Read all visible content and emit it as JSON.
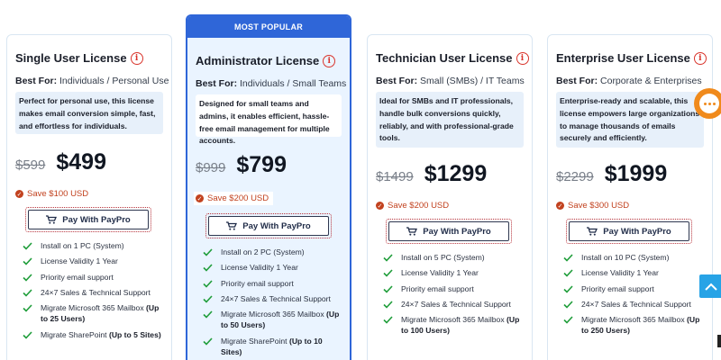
{
  "colors": {
    "accent_blue": "#2f66d8",
    "save_red": "#c2421f",
    "check_green": "#1f9d3a",
    "chat_orange": "#f08a1c",
    "scroll_blue": "#27a3e6"
  },
  "icons": {
    "info": "info-circle-icon",
    "save": "check-badge-icon",
    "cart": "cart-icon",
    "feature": "checkmark-icon",
    "chat": "chat-icon",
    "scroll_top": "chevron-up-icon"
  },
  "best_for_label": "Best For:",
  "pay_label": "Pay With PayPro",
  "popular_banner": "MOST POPULAR",
  "plans": [
    {
      "title": "Single User License",
      "best_for": "Individuals / Personal Use",
      "description": "Perfect for personal use, this license makes email conversion simple, fast, and effortless for individuals.",
      "old_price": "$599",
      "price": "$499",
      "save": "Save $100 USD",
      "features": [
        {
          "text": "Install on 1 PC (System)",
          "bold": ""
        },
        {
          "text": "License Validity 1 Year",
          "bold": ""
        },
        {
          "text": "Priority email support",
          "bold": ""
        },
        {
          "text": "24×7 Sales & Technical Support",
          "bold": ""
        },
        {
          "text": "Migrate Microsoft 365 Mailbox ",
          "bold": "(Up to 25 Users)"
        },
        {
          "text": "Migrate SharePoint ",
          "bold": "(Up to 5 Sites)"
        }
      ]
    },
    {
      "title": "Administrator License",
      "best_for": "Individuals / Small Teams",
      "description": "Designed for small teams and admins, it enables efficient, hassle-free email management for multiple accounts.",
      "old_price": "$999",
      "price": "$799",
      "save": "Save $200 USD",
      "features": [
        {
          "text": "Install on 2 PC (System)",
          "bold": ""
        },
        {
          "text": "License Validity 1 Year",
          "bold": ""
        },
        {
          "text": "Priority email support",
          "bold": ""
        },
        {
          "text": "24×7 Sales & Technical Support",
          "bold": ""
        },
        {
          "text": "Migrate Microsoft 365 Mailbox ",
          "bold": "(Up to 50 Users)"
        },
        {
          "text": "Migrate SharePoint ",
          "bold": "(Up to 10 Sites)"
        }
      ]
    },
    {
      "title": "Technician User License",
      "best_for": "Small (SMBs) / IT Teams",
      "description": "Ideal for SMBs and IT professionals, handle bulk conversions quickly, reliably, and with professional-grade tools.",
      "old_price": "$1499",
      "price": "$1299",
      "save": "Save $200 USD",
      "features": [
        {
          "text": "Install on 5 PC (System)",
          "bold": ""
        },
        {
          "text": "License Validity 1 Year",
          "bold": ""
        },
        {
          "text": "Priority email support",
          "bold": ""
        },
        {
          "text": "24×7 Sales & Technical Support",
          "bold": ""
        },
        {
          "text": "Migrate Microsoft 365 Mailbox ",
          "bold": "(Up to 100 Users)"
        }
      ]
    },
    {
      "title": "Enterprise User License",
      "best_for": "Corporate & Enterprises",
      "description": "Enterprise-ready and scalable, this license empowers large organizations to manage thousands of emails securely and efficiently.",
      "old_price": "$2299",
      "price": "$1999",
      "save": "Save $300 USD",
      "features": [
        {
          "text": "Install on 10 PC (System)",
          "bold": ""
        },
        {
          "text": "License Validity 1 Year",
          "bold": ""
        },
        {
          "text": "Priority email support",
          "bold": ""
        },
        {
          "text": "24×7 Sales & Technical Support",
          "bold": ""
        },
        {
          "text": "Migrate Microsoft 365 Mailbox ",
          "bold": "(Up to 250 Users)"
        }
      ]
    }
  ]
}
